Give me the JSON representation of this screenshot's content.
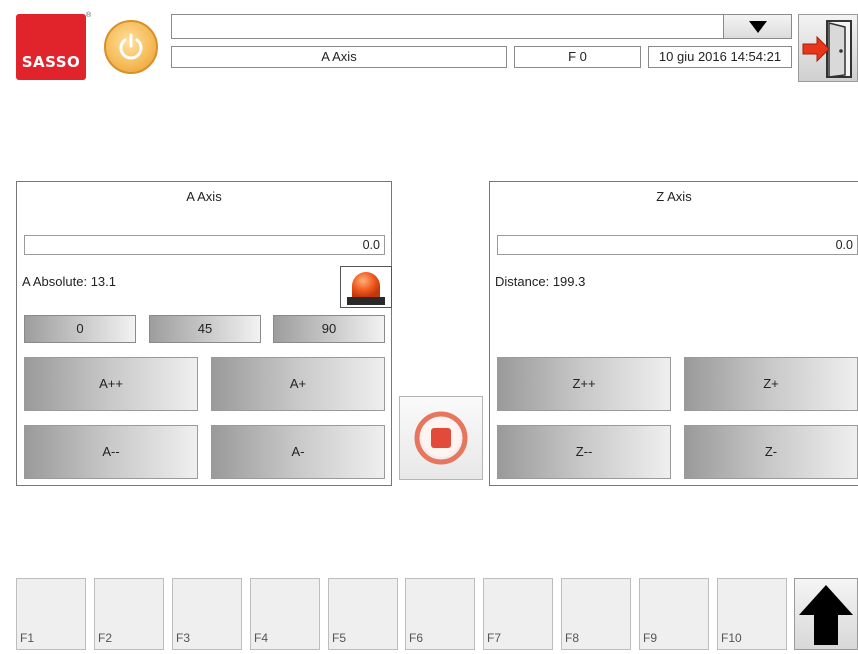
{
  "header": {
    "logo_text": "SASSO",
    "program_selector_value": "",
    "axis_title": "A Axis",
    "feed": "F 0",
    "datetime": "10 giu 2016 14:54:21"
  },
  "a_axis": {
    "title": "A Axis",
    "value": "0.0",
    "absolute_label": "A Absolute:",
    "absolute_value": "13.1",
    "presets": [
      "0",
      "45",
      "90"
    ],
    "jog": {
      "plus_plus": "A++",
      "plus": "A+",
      "minus_minus": "A--",
      "minus": "A-"
    }
  },
  "z_axis": {
    "title": "Z Axis",
    "value": "0.0",
    "distance_label": "Distance:",
    "distance_value": "199.3",
    "jog": {
      "plus_plus": "Z++",
      "plus": "Z+",
      "minus_minus": "Z--",
      "minus": "Z-"
    }
  },
  "function_keys": [
    "F1",
    "F2",
    "F3",
    "F4",
    "F5",
    "F6",
    "F7",
    "F8",
    "F9",
    "F10"
  ],
  "colors": {
    "brand_red": "#e1242b",
    "power_orange": "#f6bd5b",
    "stop_ring": "#e8765f",
    "alarm_orange": "#f05a1e"
  },
  "icons": {
    "power": "power-icon",
    "dropdown": "triangle-down-icon",
    "exit": "exit-door-icon",
    "alarm": "alarm-beacon-icon",
    "stop": "stop-icon",
    "up": "up-arrow-icon"
  }
}
